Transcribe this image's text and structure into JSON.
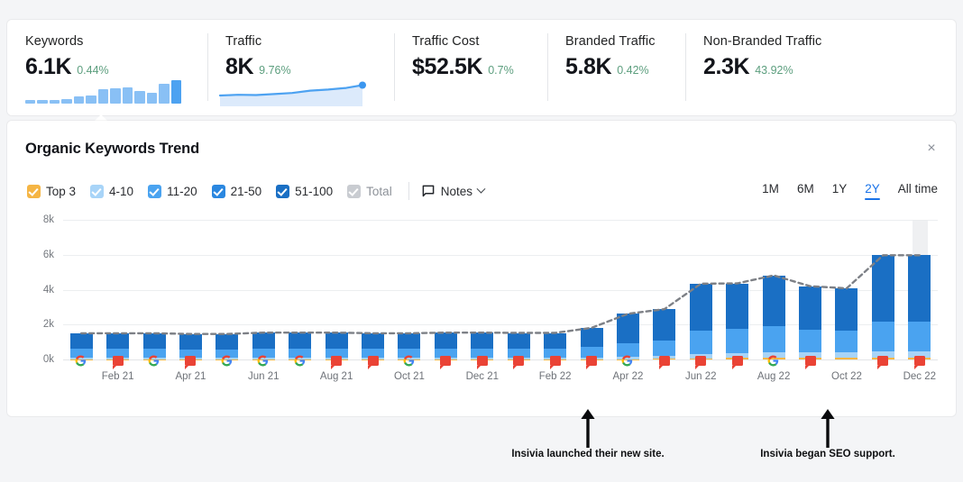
{
  "metrics": [
    {
      "label": "Keywords",
      "value": "6.1K",
      "delta": "0.44%",
      "spark": "bars"
    },
    {
      "label": "Traffic",
      "value": "8K",
      "delta": "9.76%",
      "spark": "area"
    },
    {
      "label": "Traffic Cost",
      "value": "$52.5K",
      "delta": "0.7%",
      "spark": "none"
    },
    {
      "label": "Branded Traffic",
      "value": "5.8K",
      "delta": "0.42%",
      "spark": "none"
    },
    {
      "label": "Non-Branded Traffic",
      "value": "2.3K",
      "delta": "43.92%",
      "spark": "none"
    }
  ],
  "keywords_sparkline": [
    3,
    3,
    3,
    4,
    6,
    7,
    12,
    13,
    14,
    11,
    9,
    17,
    20
  ],
  "panel": {
    "title": "Organic Keywords Trend",
    "close_label": "×",
    "notes_label": "Notes"
  },
  "legend": [
    {
      "label": "Top 3",
      "color": "#f5b544",
      "checked": true
    },
    {
      "label": "4-10",
      "color": "#a8d4f8",
      "checked": true
    },
    {
      "label": "11-20",
      "color": "#4aa3f0",
      "checked": true
    },
    {
      "label": "21-50",
      "color": "#2a87e0",
      "checked": true
    },
    {
      "label": "51-100",
      "color": "#1a6fc4",
      "checked": true
    },
    {
      "label": "Total",
      "color": "#c9ccd1",
      "checked": false
    }
  ],
  "ranges": [
    {
      "label": "1M",
      "active": false
    },
    {
      "label": "6M",
      "active": false
    },
    {
      "label": "1Y",
      "active": false
    },
    {
      "label": "2Y",
      "active": true
    },
    {
      "label": "All time",
      "active": false
    }
  ],
  "chart_data": {
    "type": "bar",
    "title": "Organic Keywords Trend",
    "xlabel": "",
    "ylabel": "",
    "ylim": [
      0,
      8000
    ],
    "yticks": [
      0,
      2000,
      4000,
      6000,
      8000
    ],
    "ytick_labels": [
      "0k",
      "2k",
      "4k",
      "6k",
      "8k"
    ],
    "grid": true,
    "stacked": true,
    "legend_position": "top-left",
    "categories": [
      "Jan 21",
      "Feb 21",
      "Mar 21",
      "Apr 21",
      "May 21",
      "Jun 21",
      "Jul 21",
      "Aug 21",
      "Sep 21",
      "Oct 21",
      "Nov 21",
      "Dec 21",
      "Jan 22",
      "Feb 22",
      "Mar 22",
      "Apr 22",
      "May 22",
      "Jun 22",
      "Jul 22",
      "Aug 22",
      "Sep 22",
      "Oct 22",
      "Nov 22",
      "Dec 22"
    ],
    "tick_labels": [
      "Feb 21",
      "Apr 21",
      "Jun 21",
      "Aug 21",
      "Oct 21",
      "Dec 21",
      "Feb 22",
      "Apr 22",
      "Jun 22",
      "Aug 22",
      "Oct 22",
      "Dec 22"
    ],
    "series": [
      {
        "name": "Top 3",
        "color": "#f5b544",
        "values": [
          20,
          20,
          20,
          20,
          20,
          20,
          20,
          20,
          20,
          20,
          20,
          20,
          20,
          20,
          20,
          25,
          35,
          60,
          80,
          95,
          95,
          95,
          110,
          110
        ]
      },
      {
        "name": "4-10",
        "color": "#a8d4f8",
        "values": [
          60,
          60,
          60,
          60,
          60,
          60,
          60,
          60,
          60,
          60,
          60,
          60,
          60,
          60,
          70,
          110,
          150,
          230,
          280,
          320,
          300,
          300,
          360,
          360
        ]
      },
      {
        "name": "11-20",
        "color": "#4aa3f0",
        "values": [
          520,
          520,
          520,
          500,
          500,
          540,
          540,
          540,
          520,
          520,
          540,
          540,
          540,
          540,
          620,
          780,
          900,
          1350,
          1400,
          1500,
          1300,
          1280,
          1700,
          1700
        ]
      },
      {
        "name": "21-50",
        "color": "#2a87e0",
        "values": [
          0,
          0,
          0,
          0,
          0,
          0,
          0,
          0,
          0,
          0,
          0,
          0,
          0,
          0,
          0,
          0,
          0,
          0,
          0,
          0,
          0,
          0,
          0,
          0
        ]
      },
      {
        "name": "51-100",
        "color": "#1a6fc4",
        "values": [
          900,
          900,
          900,
          880,
          880,
          920,
          920,
          920,
          900,
          900,
          920,
          920,
          900,
          900,
          1100,
          1700,
          1800,
          2700,
          2600,
          2900,
          2500,
          2400,
          3800,
          3800
        ]
      }
    ],
    "totals": [
      1500,
      1500,
      1500,
      1460,
      1460,
      1540,
      1540,
      1540,
      1500,
      1500,
      1540,
      1540,
      1520,
      1520,
      1810,
      2615,
      2885,
      4340,
      4360,
      4815,
      4195,
      4075,
      5970,
      5970
    ],
    "trend_line": {
      "name": "Total",
      "style": "dashed",
      "color": "#7d8086"
    }
  },
  "bar_markers": [
    {
      "index": 0,
      "type": "google"
    },
    {
      "index": 1,
      "type": "note"
    },
    {
      "index": 2,
      "type": "google"
    },
    {
      "index": 3,
      "type": "note"
    },
    {
      "index": 4,
      "type": "google"
    },
    {
      "index": 5,
      "type": "google"
    },
    {
      "index": 6,
      "type": "google"
    },
    {
      "index": 7,
      "type": "note"
    },
    {
      "index": 8,
      "type": "note"
    },
    {
      "index": 9,
      "type": "google"
    },
    {
      "index": 10,
      "type": "note"
    },
    {
      "index": 11,
      "type": "note"
    },
    {
      "index": 12,
      "type": "note"
    },
    {
      "index": 13,
      "type": "note"
    },
    {
      "index": 14,
      "type": "note"
    },
    {
      "index": 15,
      "type": "google"
    },
    {
      "index": 16,
      "type": "note"
    },
    {
      "index": 17,
      "type": "note"
    },
    {
      "index": 18,
      "type": "note"
    },
    {
      "index": 19,
      "type": "google"
    },
    {
      "index": 20,
      "type": "note"
    },
    {
      "index": 21,
      "type": "none"
    },
    {
      "index": 22,
      "type": "note"
    },
    {
      "index": 23,
      "type": "note"
    }
  ],
  "annotations": [
    {
      "text": "Insivia launched their new site.",
      "x": 652
    },
    {
      "text": "Insivia began SEO support.",
      "x": 918
    }
  ]
}
